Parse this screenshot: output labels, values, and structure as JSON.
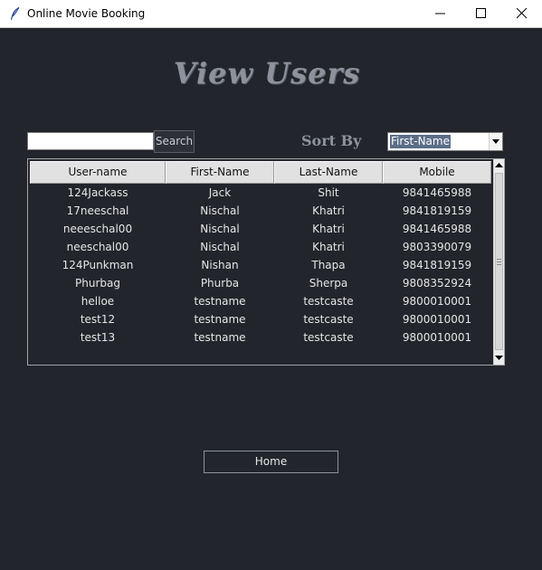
{
  "window": {
    "title": "Online Movie Booking",
    "controls": [
      "minimize-icon",
      "maximize-icon",
      "close-icon"
    ]
  },
  "page_title": "View Users",
  "search": {
    "value": "",
    "placeholder": "",
    "button_label": "Search"
  },
  "sort": {
    "label": "Sort By",
    "selected": "First-Name"
  },
  "table": {
    "columns": [
      "User-name",
      "First-Name",
      "Last-Name",
      "Mobile"
    ],
    "rows": [
      [
        "124Jackass",
        "Jack",
        "Shit",
        "9841465988"
      ],
      [
        "17neeschal",
        "Nischal",
        "Khatri",
        "9841819159"
      ],
      [
        "neeeschal00",
        "Nischal",
        "Khatri",
        "9841465988"
      ],
      [
        "neeschal00",
        "Nischal",
        "Khatri",
        "9803390079"
      ],
      [
        "124Punkman",
        "Nishan",
        "Thapa",
        "9841819159"
      ],
      [
        "Phurbag",
        "Phurba",
        "Sherpa",
        "9808352924"
      ],
      [
        "helloe",
        "testname",
        "testcaste",
        "9800010001"
      ],
      [
        "test12",
        "testname",
        "testcaste",
        "9800010001"
      ],
      [
        "test13",
        "testname",
        "testcaste",
        "9800010001"
      ]
    ]
  },
  "home_button_label": "Home",
  "colors": {
    "background": "#22252b",
    "title_text": "#8e929c",
    "cell_text": "#e6e6e6",
    "selection": "#5b6d87"
  }
}
